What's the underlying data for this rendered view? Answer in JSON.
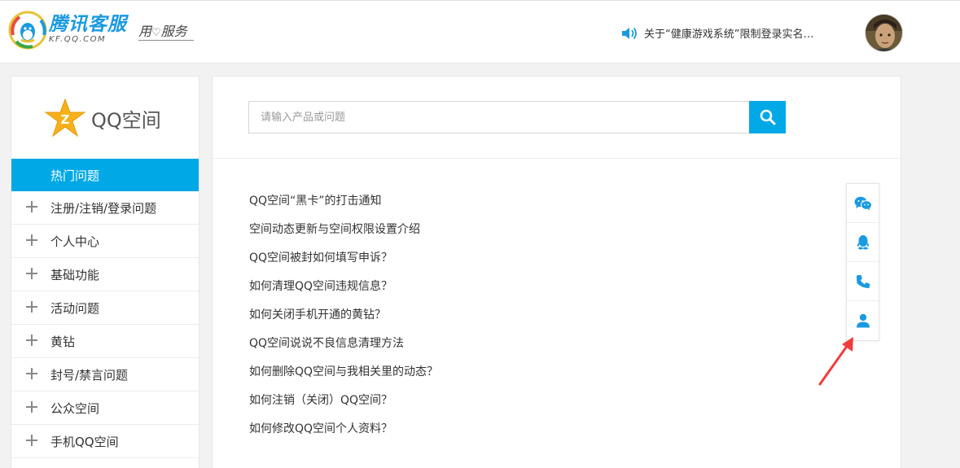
{
  "header": {
    "brand_name": "腾讯客服",
    "brand_domain": "KF.QQ.COM",
    "slogan_left": "用",
    "slogan_heart": "♡",
    "slogan_right": "服务",
    "notice_text": "关于“健康游戏系统”限制登录实名…"
  },
  "sidebar": {
    "product_title": "QQ空间",
    "items": [
      {
        "label": "热门问题"
      },
      {
        "label": "注册/注销/登录问题"
      },
      {
        "label": "个人中心"
      },
      {
        "label": "基础功能"
      },
      {
        "label": "活动问题"
      },
      {
        "label": "黄钻"
      },
      {
        "label": "封号/禁言问题"
      },
      {
        "label": "公众空间"
      },
      {
        "label": "手机QQ空间"
      }
    ]
  },
  "search": {
    "placeholder": "请输入产品或问题",
    "value": ""
  },
  "faq": [
    "QQ空间“黑卡”的打击通知",
    "空间动态更新与空间权限设置介绍",
    "QQ空间被封如何填写申诉？",
    "如何清理QQ空间违规信息？",
    "如何关闭手机开通的黄钻？",
    "QQ空间说说不良信息清理方法",
    "如何删除QQ空间与我相关里的动态？",
    "如何注销（关闭）QQ空间？",
    "如何修改QQ空间个人资料？"
  ],
  "float_bar": [
    "wechat-icon",
    "qq-icon",
    "phone-icon",
    "user-icon"
  ],
  "colors": {
    "accent": "#00a8e6",
    "brand": "#1a9ae0",
    "annotation_arrow": "#f03c3c"
  }
}
